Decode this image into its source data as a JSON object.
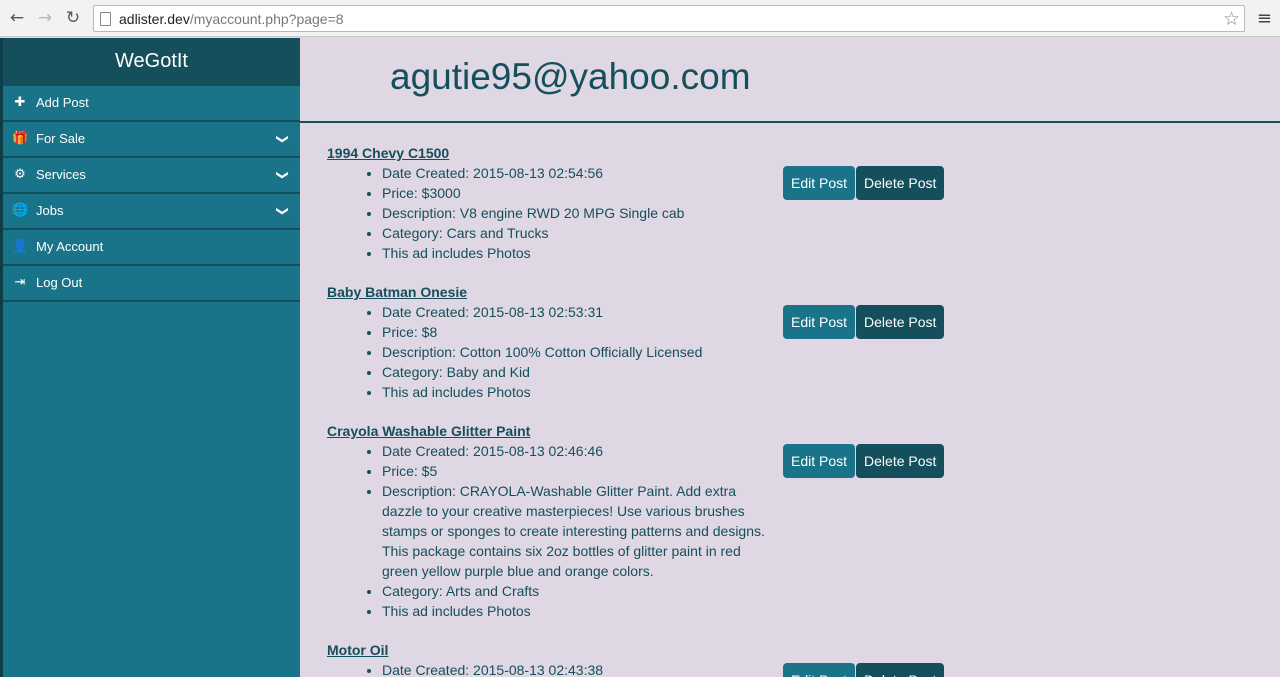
{
  "browser": {
    "url_host": "adlister.dev",
    "url_path": "/myaccount.php?page=8",
    "back_icon": "←",
    "forward_icon": "→",
    "reload_icon": "↻",
    "star_icon": "☆",
    "menu_icon": "≡"
  },
  "sidebar": {
    "brand": "WeGotIt",
    "items": [
      {
        "label": "Add Post",
        "icon": "✚",
        "chevron": ""
      },
      {
        "label": "For Sale",
        "icon": "🎁",
        "chevron": "❯"
      },
      {
        "label": "Services",
        "icon": "⚙",
        "chevron": "❯"
      },
      {
        "label": "Jobs",
        "icon": "🌐",
        "chevron": "❯"
      },
      {
        "label": "My Account",
        "icon": "👤",
        "chevron": ""
      },
      {
        "label": "Log Out",
        "icon": "⇥",
        "chevron": ""
      }
    ]
  },
  "header": {
    "title": "agutie95@yahoo.com"
  },
  "buttons": {
    "edit": "Edit Post",
    "delete": "Delete Post"
  },
  "posts": [
    {
      "title": "1994 Chevy C1500",
      "details": [
        "Date Created: 2015-08-13 02:54:56",
        "Price: $3000",
        "Description: V8 engine RWD 20 MPG Single cab",
        "Category: Cars and Trucks",
        "This ad includes Photos"
      ]
    },
    {
      "title": "Baby Batman Onesie",
      "details": [
        "Date Created: 2015-08-13 02:53:31",
        "Price: $8",
        "Description: Cotton 100% Cotton Officially Licensed",
        "Category: Baby and Kid",
        "This ad includes Photos"
      ]
    },
    {
      "title": "Crayola Washable Glitter Paint",
      "details": [
        "Date Created: 2015-08-13 02:46:46",
        "Price: $5",
        "Description: CRAYOLA-Washable Glitter Paint. Add extra dazzle to your creative masterpieces! Use various brushes stamps or sponges to create interesting patterns and designs. This package contains six 2oz bottles of glitter paint in red green yellow purple blue and orange colors.",
        "Category: Arts and Crafts",
        "This ad includes Photos"
      ]
    },
    {
      "title": "Motor Oil",
      "details": [
        "Date Created: 2015-08-13 02:43:38"
      ]
    }
  ]
}
